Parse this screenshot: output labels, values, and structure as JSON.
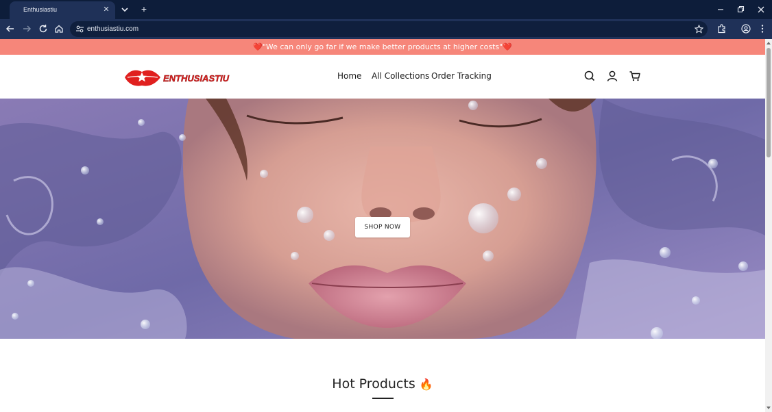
{
  "browser": {
    "tab_title": "Enthusiastiu",
    "url": "enthusiastiu.com"
  },
  "announcement": {
    "text": "❤️\"We can only go far if we make better products at higher costs\"❤️"
  },
  "header": {
    "logo_text": "ENTHUSIASTIU",
    "nav": [
      {
        "label": "Home"
      },
      {
        "label": "All Collections"
      },
      {
        "label": "Order Tracking"
      }
    ],
    "icons": [
      "search-icon",
      "account-icon",
      "cart-icon"
    ]
  },
  "hero": {
    "button_label": "SHOP NOW"
  },
  "sections": {
    "hot_products_title": "Hot Products",
    "hot_products_emoji": "🔥"
  },
  "colors": {
    "announcement_bg": "#f6867a",
    "brand_red": "#e0201f",
    "chrome_dark": "#0d1d3a",
    "chrome_toolbar": "#1f3158"
  }
}
